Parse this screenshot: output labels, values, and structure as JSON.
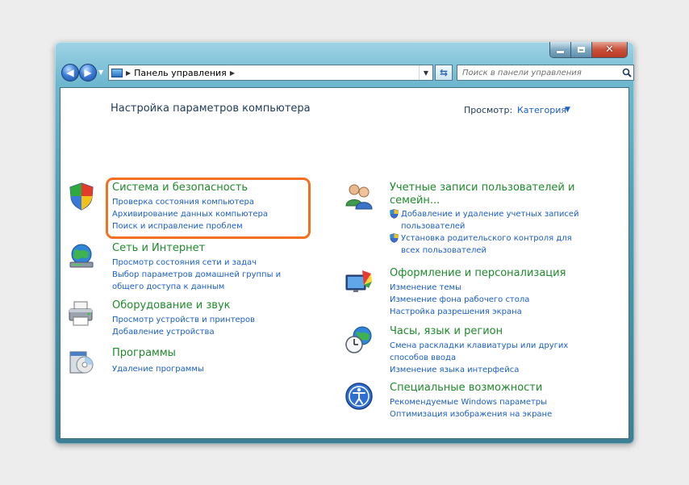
{
  "nav": {
    "breadcrumb": "Панель управления",
    "search_placeholder": "Поиск в панели управления"
  },
  "header": {
    "title": "Настройка параметров компьютера",
    "view_label": "Просмотр:",
    "view_value": "Категория"
  },
  "left_categories": [
    {
      "title": "Система и безопасность",
      "icon": "shield-icon",
      "links": [
        "Проверка состояния компьютера",
        "Архивирование данных компьютера",
        "Поиск и исправление проблем"
      ]
    },
    {
      "title": "Сеть и Интернет",
      "icon": "globe-network-icon",
      "links": [
        "Просмотр состояния сети и задач",
        "Выбор параметров домашней группы и",
        "общего доступа к данным"
      ]
    },
    {
      "title": "Оборудование и звук",
      "icon": "printer-icon",
      "links": [
        "Просмотр устройств и принтеров",
        "Добавление устройства"
      ]
    },
    {
      "title": "Программы",
      "icon": "programs-icon",
      "links": [
        "Удаление программы"
      ]
    }
  ],
  "right_categories": [
    {
      "title_line1": "Учетные записи пользователей и",
      "title_line2": "семейн...",
      "icon": "users-icon",
      "links": [
        {
          "line1": "Добавление и удаление учетных записей",
          "line2": "пользователей"
        },
        {
          "line1": "Установка родительского контроля для",
          "line2": "всех пользователей"
        }
      ]
    },
    {
      "title": "Оформление и персонализация",
      "icon": "personalization-icon",
      "links": [
        "Изменение темы",
        "Изменение фона рабочего стола",
        "Настройка разрешения экрана"
      ]
    },
    {
      "title": "Часы, язык и регион",
      "icon": "clock-globe-icon",
      "links": [
        "Смена раскладки клавиатуры или других",
        "способов ввода",
        "Изменение языка интерфейса"
      ]
    },
    {
      "title": "Специальные возможности",
      "icon": "accessibility-icon",
      "links": [
        "Рекомендуемые Windows параметры",
        "Оптимизация изображения на экране"
      ]
    }
  ],
  "colors": {
    "highlight": "#f37021",
    "category_title": "#1e8a2b",
    "link": "#1a5ec7",
    "heading": "#1e395b"
  }
}
